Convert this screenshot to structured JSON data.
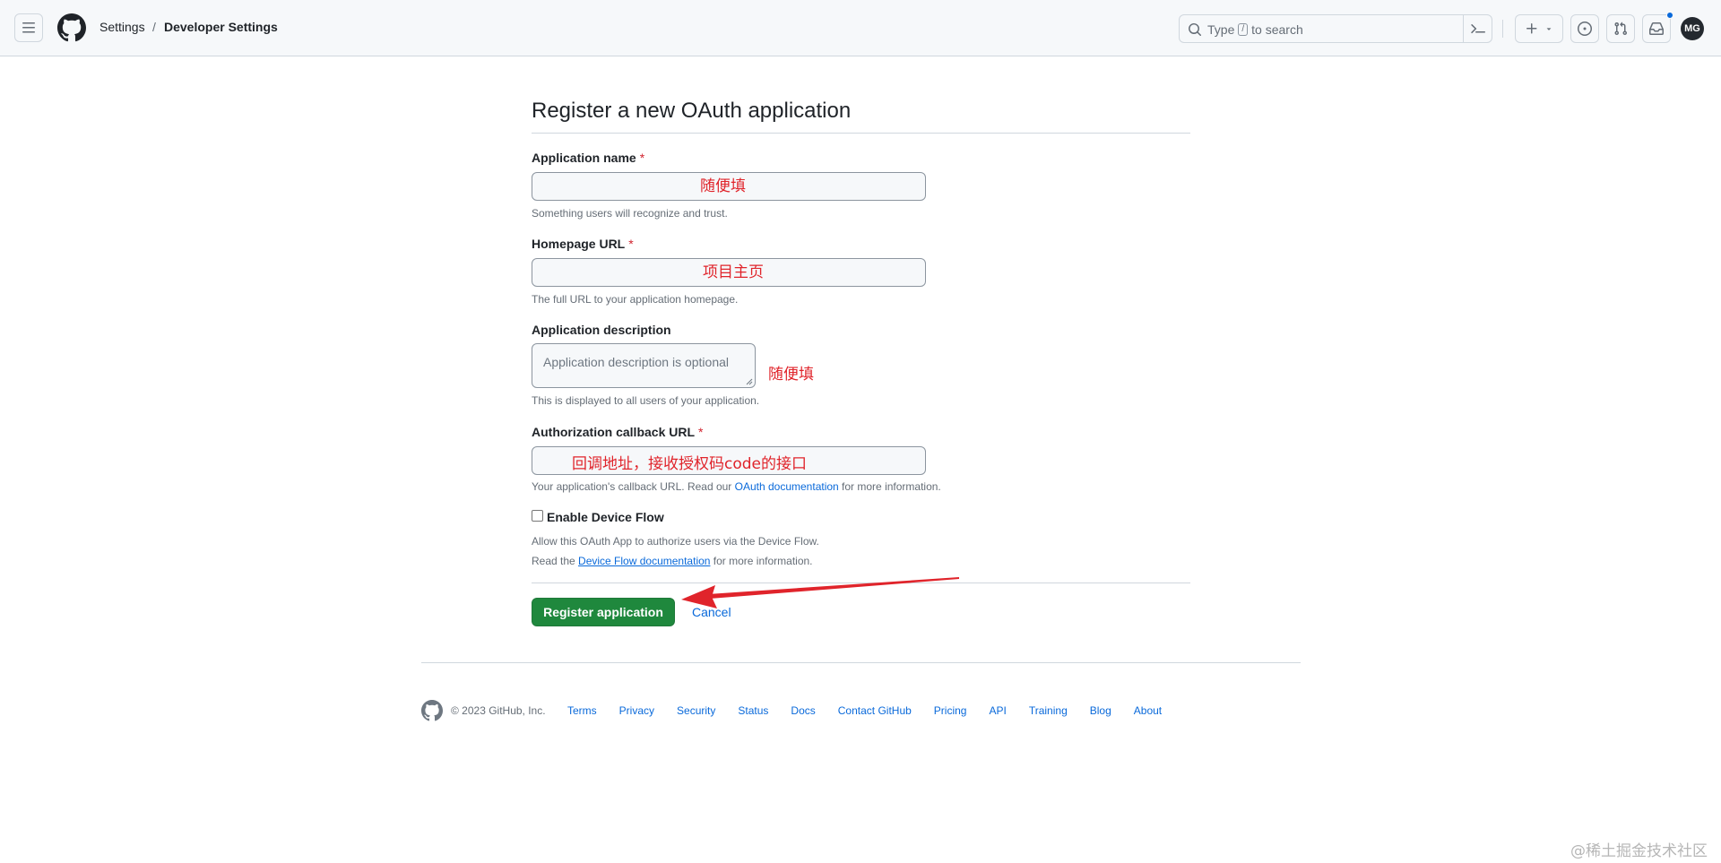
{
  "header": {
    "breadcrumb": [
      "Settings",
      "/",
      "Developer Settings"
    ],
    "search": {
      "prefix": "Type",
      "key": "/",
      "suffix": "to search"
    },
    "avatar_initials": "MG",
    "icons": [
      "hamburger-icon",
      "github-logo",
      "search-icon",
      "command-palette-icon",
      "plus-icon",
      "chevron-down-icon",
      "issue-icon",
      "pull-request-icon",
      "inbox-icon"
    ]
  },
  "form": {
    "title": "Register a new OAuth application",
    "required_mark": "*",
    "app_name": {
      "label": "Application name",
      "note": "Something users will recognize and trust."
    },
    "homepage": {
      "label": "Homepage URL",
      "note": "The full URL to your application homepage."
    },
    "description": {
      "label": "Application description",
      "placeholder": "Application description is optional",
      "note": "This is displayed to all users of your application."
    },
    "callback": {
      "label": "Authorization callback URL",
      "note_pre": "Your application's callback URL. Read our ",
      "note_link": "OAuth documentation",
      "note_post": " for more information."
    },
    "device_flow": {
      "label": "Enable Device Flow",
      "note1": "Allow this OAuth App to authorize users via the Device Flow.",
      "note2_pre": "Read the ",
      "note2_link": "Device Flow documentation",
      "note2_post": " for more information."
    },
    "submit_label": "Register application",
    "cancel_label": "Cancel"
  },
  "annotations": {
    "app_name": "随便填",
    "homepage": "项目主页",
    "description": "随便填",
    "callback": "回调地址，接收授权码code的接口",
    "arrow_color": "#e0242b"
  },
  "footer": {
    "copyright": "© 2023 GitHub, Inc.",
    "links": [
      "Terms",
      "Privacy",
      "Security",
      "Status",
      "Docs",
      "Contact GitHub",
      "Pricing",
      "API",
      "Training",
      "Blog",
      "About"
    ]
  },
  "watermark": "@稀土掘金技术社区",
  "colors": {
    "accent": "#0969da",
    "primary_button": "#1f883d",
    "required": "#d1242f"
  }
}
